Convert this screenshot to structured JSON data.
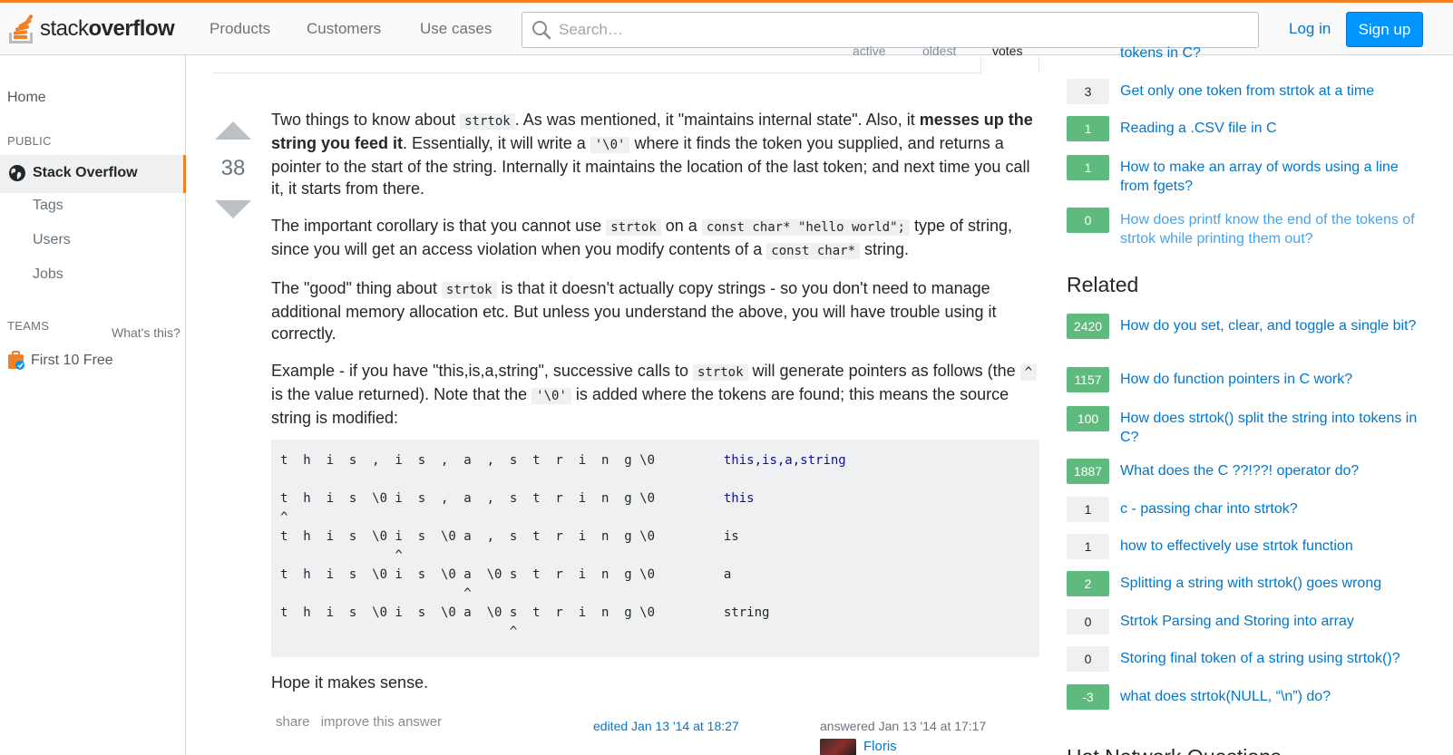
{
  "header": {
    "logo_light": "stack",
    "logo_bold": "overflow",
    "nav": [
      "Products",
      "Customers",
      "Use cases"
    ],
    "search_placeholder": "Search…",
    "login_label": "Log in",
    "signup_label": "Sign up"
  },
  "leftnav": {
    "home": "Home",
    "public_label": "PUBLIC",
    "active_item": "Stack Overflow",
    "sub_items": [
      "Tags",
      "Users",
      "Jobs"
    ],
    "teams_label": "TEAMS",
    "whats_this": "What's this?",
    "first_free": "First 10 Free"
  },
  "answer": {
    "tabs_cut": [
      "active",
      "oldest",
      "votes"
    ],
    "votes": "38",
    "p1": {
      "a": "Two things to know about ",
      "code1": "strtok",
      "b": ". As was mentioned, it \"maintains internal state\". Also, it ",
      "bold": "messes up the string you feed it",
      "c": ". Essentially, it will write a ",
      "code2": "'\\0'",
      "d": " where it finds the token you supplied, and returns a pointer to the start of the string. Internally it maintains the location of the last token; and next time you call it, it starts from there."
    },
    "p2": {
      "a": "The important corollary is that you cannot use ",
      "code1": "strtok",
      "b": " on a ",
      "code2": "const char* \"hello world\";",
      "c": " type of string, since you will get an access violation when you modify contents of a ",
      "code3": "const char*",
      "d": " string."
    },
    "p3": {
      "a": "The \"good\" thing about ",
      "code1": "strtok",
      "b": " is that it doesn't actually copy strings - so you don't need to manage additional memory allocation etc. But unless you understand the above, you will have trouble using it correctly."
    },
    "p4": {
      "a": "Example - if you have \"this,is,a,string\", successive calls to ",
      "code1": "strtok",
      "b": " will generate pointers as follows (the ",
      "code2": "^",
      "c": " is the value returned). Note that the ",
      "code3": "'\\0'",
      "d": " is added where the tokens are found; this means the source string is modified:"
    },
    "code_lines": [
      {
        "left": "t  h  i  s  ,  i  s  ,  a  ,  s  t  r  i  n  g \\0         ",
        "right": "this,is,a,string",
        "kw": true
      },
      {
        "left": "",
        "right": "",
        "kw": false
      },
      {
        "left": "t  h  i  s  \\0 i  s  ,  a  ,  s  t  r  i  n  g \\0         ",
        "right": "this",
        "kw": true
      },
      {
        "left": "^",
        "right": "",
        "kw": false
      },
      {
        "left": "t  h  i  s  \\0 i  s  \\0 a  ,  s  t  r  i  n  g \\0         ",
        "right": "is",
        "kw": false
      },
      {
        "left": "               ^",
        "right": "",
        "kw": false
      },
      {
        "left": "t  h  i  s  \\0 i  s  \\0 a  \\0 s  t  r  i  n  g \\0         ",
        "right": "a",
        "kw": false
      },
      {
        "left": "                        ^",
        "right": "",
        "kw": false
      },
      {
        "left": "t  h  i  s  \\0 i  s  \\0 a  \\0 s  t  r  i  n  g \\0         ",
        "right": "string",
        "kw": false
      },
      {
        "left": "                              ^",
        "right": "",
        "kw": false
      }
    ],
    "closing": "Hope it makes sense.",
    "menu": [
      "share",
      "improve this answer"
    ],
    "edited": "edited Jan 13 '14 at 18:27",
    "answered": "answered Jan 13 '14 at 17:17",
    "author": "Floris"
  },
  "right_sidebar": {
    "linked_cut": "tokens in C?",
    "linked": [
      {
        "count": "3",
        "title": "Get only one token from strtok at a time",
        "accepted": false,
        "visited": false
      },
      {
        "count": "1",
        "title": "Reading a .CSV file in C",
        "accepted": true,
        "visited": false
      },
      {
        "count": "1",
        "title": "How to make an array of words using a line from fgets?",
        "accepted": true,
        "visited": false
      },
      {
        "count": "0",
        "title": "How does printf know the end of the tokens of strtok while printing them out?",
        "accepted": true,
        "visited": true
      }
    ],
    "related_heading": "Related",
    "related": [
      {
        "count": "2420",
        "title": "How do you set, clear, and toggle a single bit?",
        "accepted": true
      },
      {
        "count": "1157",
        "title": "How do function pointers in C work?",
        "accepted": true
      },
      {
        "count": "100",
        "title": "How does strtok() split the string into tokens in C?",
        "accepted": true
      },
      {
        "count": "1887",
        "title": "What does the C ??!??! operator do?",
        "accepted": true
      },
      {
        "count": "1",
        "title": "c - passing char into strtok?",
        "accepted": false
      },
      {
        "count": "1",
        "title": "how to effectively use strtok function",
        "accepted": false
      },
      {
        "count": "2",
        "title": "Splitting a string with strtok() goes wrong",
        "accepted": true
      },
      {
        "count": "0",
        "title": "Strtok Parsing and Storing into array",
        "accepted": false
      },
      {
        "count": "0",
        "title": "Storing final token of a string using strtok()?",
        "accepted": false
      },
      {
        "count": "-3",
        "title": "what does strtok(NULL, “\\n”) do?",
        "accepted": true
      }
    ],
    "hot_heading": "Hot Network Questions"
  },
  "colors": {
    "brand_orange": "#f48024",
    "link_blue": "#0077cc",
    "accepted_green": "#5eba7d",
    "signup_blue": "#0095ff"
  }
}
